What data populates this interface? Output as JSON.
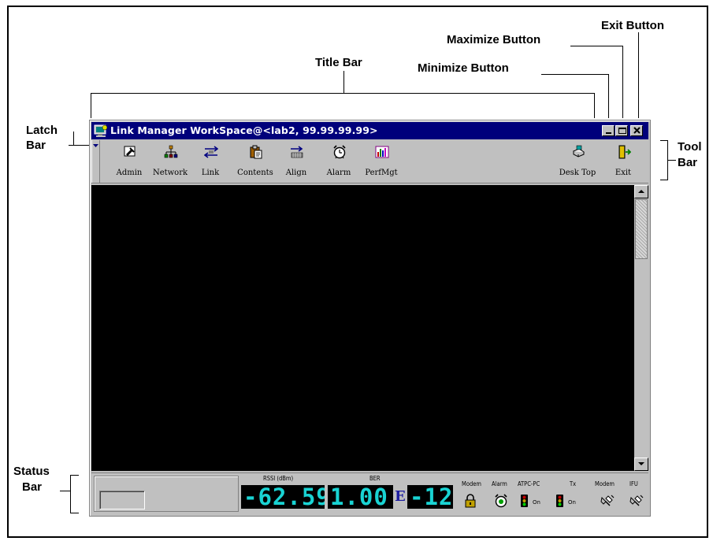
{
  "callouts": {
    "exit_button": "Exit Button",
    "maximize_button": "Maximize Button",
    "title_bar": "Title Bar",
    "minimize_button": "Minimize Button",
    "latch_bar_line1": "Latch",
    "latch_bar_line2": "Bar",
    "tool_bar_line1": "Tool",
    "tool_bar_line2": "Bar",
    "status_bar_line1": "Status",
    "status_bar_line2": "Bar"
  },
  "window": {
    "title": "Link Manager WorkSpace@<lab2, 99.99.99.99>",
    "accent_color": "#00007b"
  },
  "toolbar": {
    "items": [
      {
        "label": "Admin",
        "icon": "admin-icon"
      },
      {
        "label": "Network",
        "icon": "network-icon"
      },
      {
        "label": "Link",
        "icon": "link-icon"
      },
      {
        "label": "Contents",
        "icon": "contents-icon"
      },
      {
        "label": "Align",
        "icon": "align-icon"
      },
      {
        "label": "Alarm",
        "icon": "alarm-clock-icon"
      },
      {
        "label": "PerfMgt",
        "icon": "performance-chart-icon"
      },
      {
        "label": "Desk Top",
        "icon": "desktop-icon"
      },
      {
        "label": "Exit",
        "icon": "exit-door-icon"
      }
    ]
  },
  "status_bar": {
    "rssi_label": "RSSI (dBm)",
    "rssi_value": "-62.59",
    "ber_label": "BER",
    "ber_mantissa": "1.00",
    "ber_exp_symbol": "E",
    "ber_exponent": "-12",
    "indicators": [
      {
        "label": "Modem",
        "icon": "lock-icon"
      },
      {
        "label": "Alarm",
        "icon": "alarm-bell-icon"
      },
      {
        "label": "ATPC-PC",
        "icon": "traffic-light-icon",
        "state": "On"
      },
      {
        "label": "Tx",
        "icon": "traffic-light-icon",
        "state": "On"
      },
      {
        "label": "Modem",
        "icon": "plug-icon"
      },
      {
        "label": "IFU",
        "icon": "plug-icon"
      }
    ],
    "lcd_color": "#19d3d3"
  }
}
